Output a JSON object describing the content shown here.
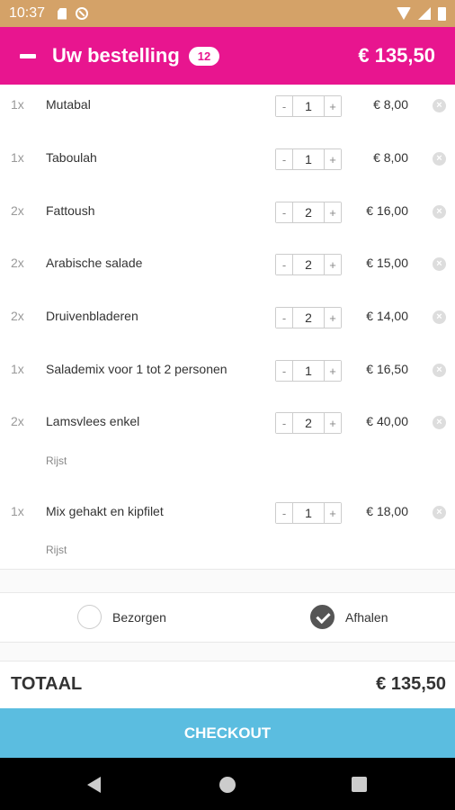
{
  "status_bar": {
    "time": "10:37"
  },
  "header": {
    "title": "Uw bestelling",
    "count": "12",
    "total": "€ 135,50"
  },
  "stepper": {
    "minus": "-",
    "plus": "+"
  },
  "remove_glyph": "×",
  "items": [
    {
      "qty": "1x",
      "name": "Mutabal",
      "value": "1",
      "price": "€ 8,00"
    },
    {
      "qty": "1x",
      "name": "Taboulah",
      "value": "1",
      "price": "€ 8,00"
    },
    {
      "qty": "2x",
      "name": "Fattoush",
      "value": "2",
      "price": "€ 16,00"
    },
    {
      "qty": "2x",
      "name": "Arabische salade",
      "value": "2",
      "price": "€ 15,00"
    },
    {
      "qty": "2x",
      "name": "Druivenbladeren",
      "value": "2",
      "price": "€ 14,00"
    },
    {
      "qty": "1x",
      "name": "Salademix voor 1 tot 2 personen",
      "value": "1",
      "price": "€ 16,50"
    },
    {
      "qty": "2x",
      "name": "Lamsvlees enkel",
      "value": "2",
      "price": "€ 40,00",
      "note": "Rijst"
    },
    {
      "qty": "1x",
      "name": "Mix gehakt en kipfilet",
      "value": "1",
      "price": "€ 18,00",
      "note": "Rijst"
    }
  ],
  "delivery": {
    "options": [
      {
        "label": "Bezorgen",
        "selected": false
      },
      {
        "label": "Afhalen",
        "selected": true
      }
    ]
  },
  "totals": {
    "label": "TOTAAL",
    "value": "€ 135,50"
  },
  "checkout": {
    "label": "CHECKOUT"
  },
  "colors": {
    "header": "#e8158f",
    "status_bar": "#d4a268",
    "checkout": "#5bbde0"
  }
}
